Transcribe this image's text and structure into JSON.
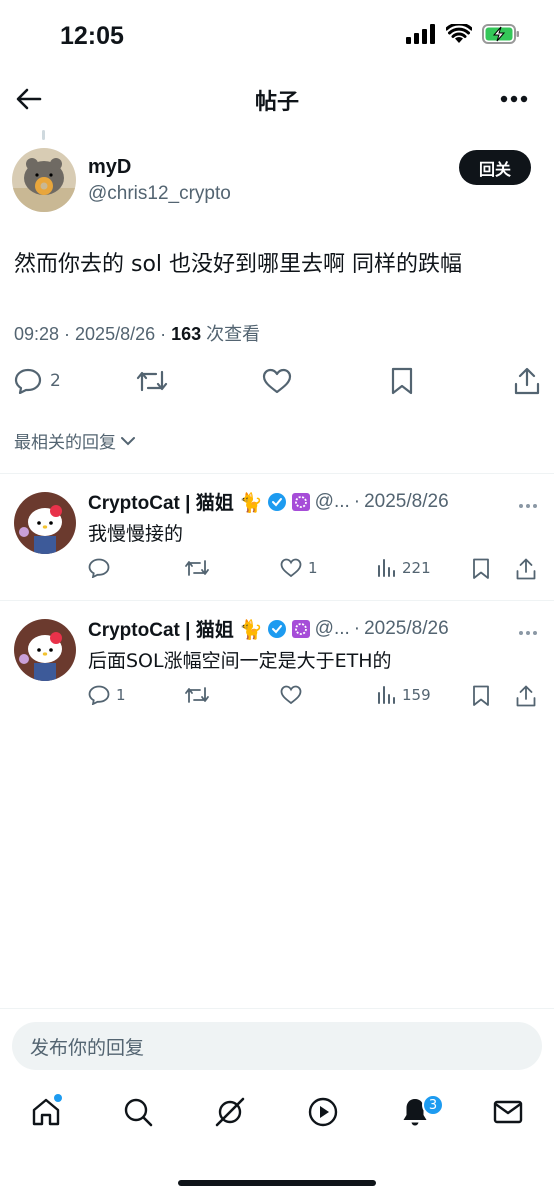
{
  "status_bar": {
    "time": "12:05"
  },
  "header": {
    "title": "帖子"
  },
  "post": {
    "author_name": "myD",
    "author_handle": "@chris12_crypto",
    "follow_label": "回关",
    "text": "然而你去的 sol 也没好到哪里去啊 同样的跌幅",
    "meta_prefix": "09:28 · 2025/8/26 · ",
    "views": "163",
    "views_label": " 次查看",
    "reply_count": "2"
  },
  "sort": {
    "label": "最相关的回复"
  },
  "replies": [
    {
      "name": "CryptoCat | 猫姐 🐈",
      "handle": "@...",
      "date": "2025/8/26",
      "text": "我慢慢接的",
      "replies": "",
      "likes": "1",
      "views": "221"
    },
    {
      "name": "CryptoCat | 猫姐 🐈",
      "handle": "@...",
      "date": "2025/8/26",
      "text": "后面SOL涨幅空间一定是大于ETH的",
      "replies": "1",
      "likes": "",
      "views": "159"
    }
  ],
  "composer": {
    "placeholder": "发布你的回复"
  },
  "tabbar": {
    "notifications_badge": "3"
  },
  "colors": {
    "accent": "#1d9bf0",
    "text": "#0f1419",
    "muted": "#536471"
  }
}
